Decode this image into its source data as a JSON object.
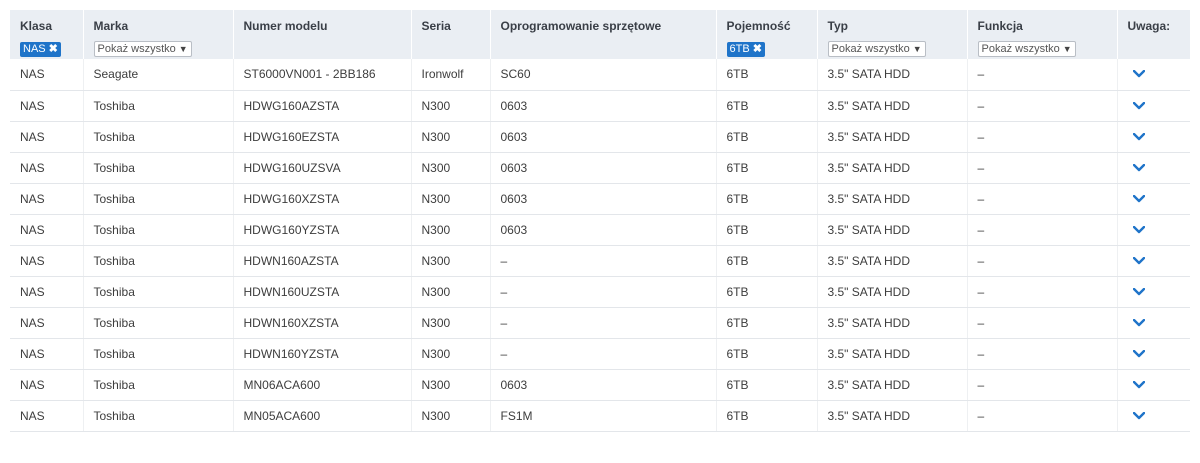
{
  "headers": {
    "klasa": "Klasa",
    "marka": "Marka",
    "numer_modelu": "Numer modelu",
    "seria": "Seria",
    "oprogramowanie": "Oprogramowanie sprzętowe",
    "pojemnosc": "Pojemność",
    "typ": "Typ",
    "funkcja": "Funkcja",
    "uwaga": "Uwaga:"
  },
  "filters": {
    "klasa_tag": "NAS",
    "marka_select": "Pokaż wszystko",
    "pojemnosc_tag": "6TB",
    "typ_select": "Pokaż wszystko",
    "funkcja_select": "Pokaż wszystko",
    "remove_icon": "close-x-icon",
    "dropdown_icon": "chevron-down-icon"
  },
  "rows": [
    [
      "NAS",
      "Seagate",
      "ST6000VN001 - 2BB186",
      "Ironwolf",
      "SC60",
      "6TB",
      "3.5\" SATA HDD",
      "–"
    ],
    [
      "NAS",
      "Toshiba",
      "HDWG160AZSTA",
      "N300",
      "0603",
      "6TB",
      "3.5\" SATA HDD",
      "–"
    ],
    [
      "NAS",
      "Toshiba",
      "HDWG160EZSTA",
      "N300",
      "0603",
      "6TB",
      "3.5\" SATA HDD",
      "–"
    ],
    [
      "NAS",
      "Toshiba",
      "HDWG160UZSVA",
      "N300",
      "0603",
      "6TB",
      "3.5\" SATA HDD",
      "–"
    ],
    [
      "NAS",
      "Toshiba",
      "HDWG160XZSTA",
      "N300",
      "0603",
      "6TB",
      "3.5\" SATA HDD",
      "–"
    ],
    [
      "NAS",
      "Toshiba",
      "HDWG160YZSTA",
      "N300",
      "0603",
      "6TB",
      "3.5\" SATA HDD",
      "–"
    ],
    [
      "NAS",
      "Toshiba",
      "HDWN160AZSTA",
      "N300",
      "–",
      "6TB",
      "3.5\" SATA HDD",
      "–"
    ],
    [
      "NAS",
      "Toshiba",
      "HDWN160UZSTA",
      "N300",
      "–",
      "6TB",
      "3.5\" SATA HDD",
      "–"
    ],
    [
      "NAS",
      "Toshiba",
      "HDWN160XZSTA",
      "N300",
      "–",
      "6TB",
      "3.5\" SATA HDD",
      "–"
    ],
    [
      "NAS",
      "Toshiba",
      "HDWN160YZSTA",
      "N300",
      "–",
      "6TB",
      "3.5\" SATA HDD",
      "–"
    ],
    [
      "NAS",
      "Toshiba",
      "MN06ACA600",
      "N300",
      "0603",
      "6TB",
      "3.5\" SATA HDD",
      "–"
    ],
    [
      "NAS",
      "Toshiba",
      "MN05ACA600",
      "N300",
      "FS1M",
      "6TB",
      "3.5\" SATA HDD",
      "–"
    ]
  ],
  "row_expand_icon": "chevron-down-icon",
  "colors": {
    "accent": "#1f74c9",
    "header_bg": "#eaeef3"
  }
}
